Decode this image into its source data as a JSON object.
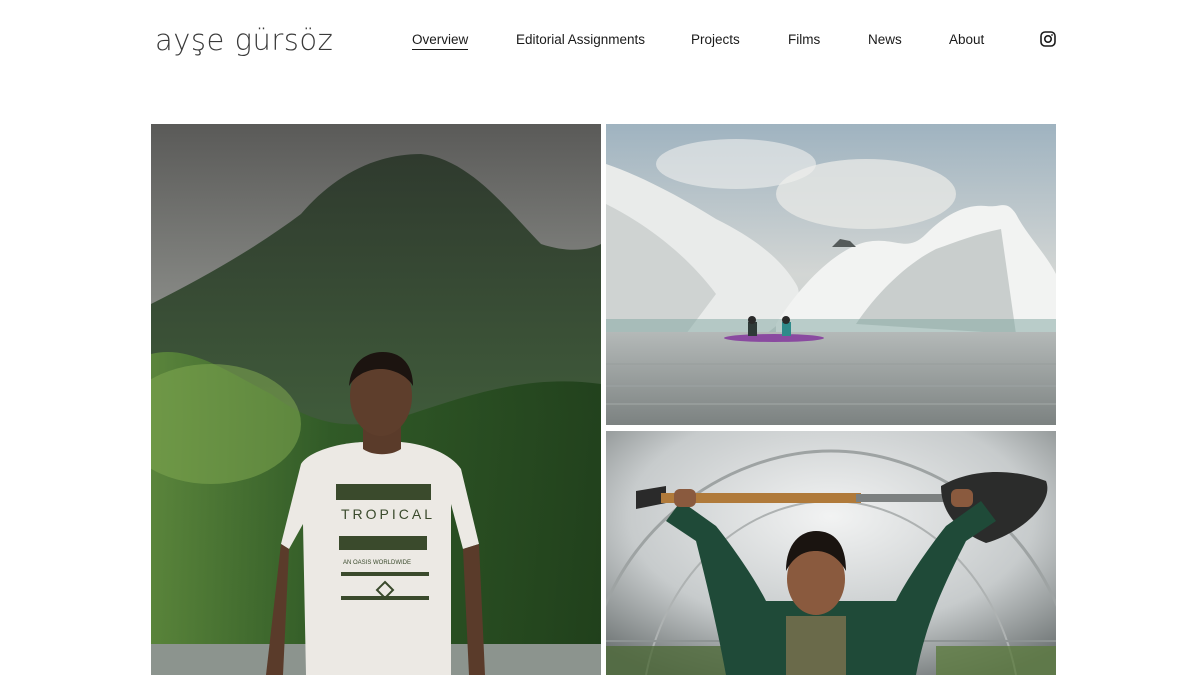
{
  "site": {
    "logo": "ayşe gürsöz"
  },
  "nav": {
    "items": [
      {
        "label": "Overview",
        "active": true
      },
      {
        "label": "Editorial Assignments",
        "active": false
      },
      {
        "label": "Projects",
        "active": false
      },
      {
        "label": "Films",
        "active": false
      },
      {
        "label": "News",
        "active": false
      },
      {
        "label": "About",
        "active": false
      }
    ],
    "social_icon": "instagram-icon"
  },
  "gallery": {
    "images": [
      {
        "subject": "man in white t-shirt in front of green mountain",
        "shirt_text_1": "TROPICAL",
        "shirt_text_2": "AN OASIS WORLDWIDE"
      },
      {
        "subject": "two kayakers among white icebergs on still water"
      },
      {
        "subject": "woman holding shovel overhead in greenhouse tunnel"
      }
    ]
  },
  "colors": {
    "text": "#1a1a1a",
    "background": "#ffffff",
    "logo": "#3a3a3a"
  }
}
